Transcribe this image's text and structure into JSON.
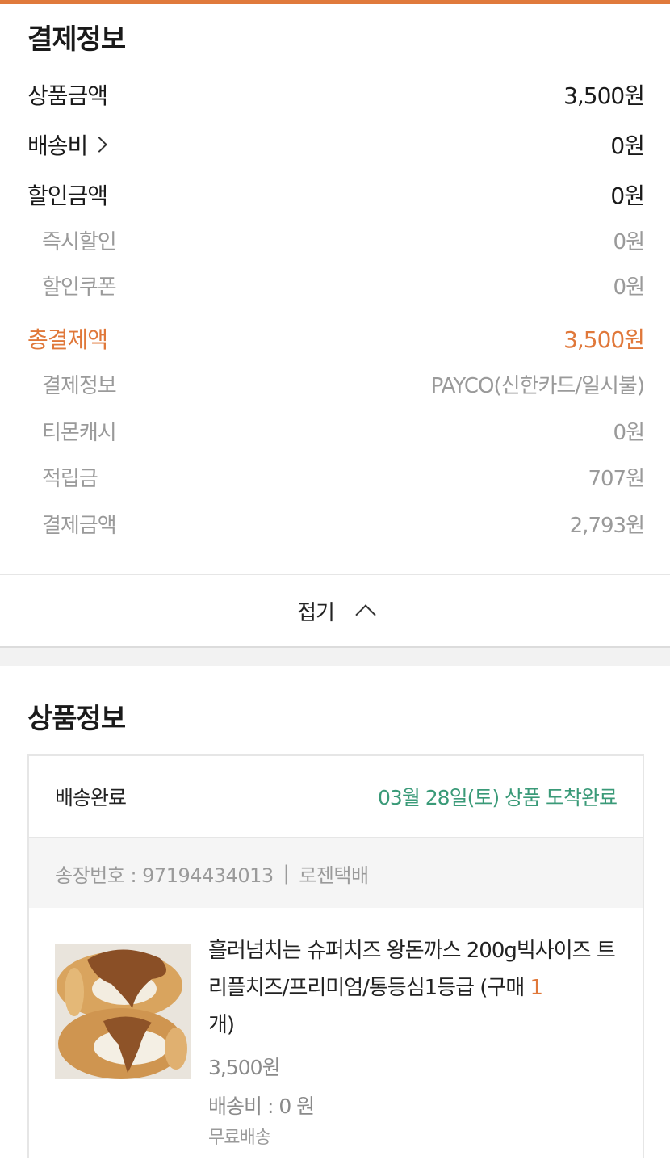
{
  "payment": {
    "title": "결제정보",
    "rows": {
      "product_amount": {
        "label": "상품금액",
        "value": "3,500원"
      },
      "shipping": {
        "label": "배송비",
        "value": "0원"
      },
      "discount": {
        "label": "할인금액",
        "value": "0원"
      },
      "instant_discount": {
        "label": "즉시할인",
        "value": "0원"
      },
      "coupon": {
        "label": "할인쿠폰",
        "value": "0원"
      },
      "total": {
        "label": "총결제액",
        "value": "3,500원"
      },
      "method": {
        "label": "결제정보",
        "value": "PAYCO(신한카드/일시불)"
      },
      "tmon_cash": {
        "label": "티몬캐시",
        "value": "0원"
      },
      "points": {
        "label": "적립금",
        "value": "707원"
      },
      "paid": {
        "label": "결제금액",
        "value": "2,793원"
      }
    },
    "fold_label": "접기"
  },
  "product": {
    "title": "상품정보",
    "status": "배송완료",
    "arrival": "03월 28일(토) 상품 도착완료",
    "tracking": "송장번호 : 97194434013",
    "tracking_sep": "|",
    "courier": "로젠택배",
    "name": "흘러넘치는 슈퍼치즈 왕돈까스 200g빅사이즈 트리플치즈/프리미엄/통등심1등급 (구매 ",
    "qty": "1",
    "qty_suffix": "개)",
    "price": "3,500원",
    "shipping_fee": "배송비 : 0 원",
    "shipping_type": "무료배송"
  },
  "colors": {
    "accent": "#e0783a",
    "arrival_green": "#3a9a78"
  }
}
